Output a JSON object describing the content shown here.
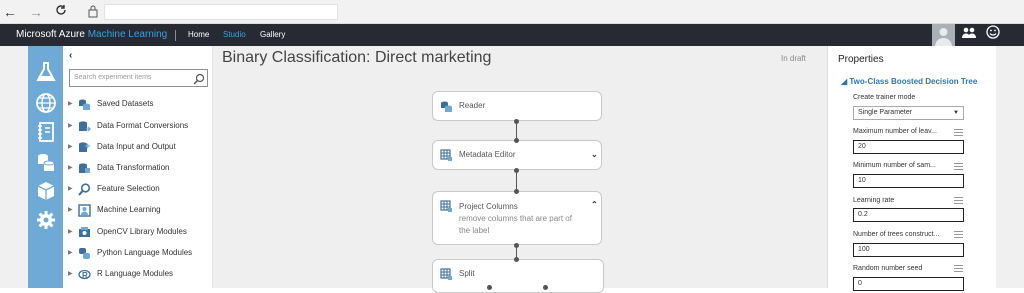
{
  "browser": {
    "back_icon": "back-arrow-icon",
    "forward_icon": "forward-arrow-icon",
    "refresh_icon": "refresh-icon",
    "lock_icon": "lock-icon",
    "address": ""
  },
  "header": {
    "brand_prefix": "Microsoft Azure",
    "brand_product": "Machine Learning",
    "nav": [
      "Home",
      "Studio",
      "Gallery"
    ],
    "active_nav": "Studio",
    "bg_color": "#272a33",
    "accent_color": "#3c9fe0"
  },
  "iconbar": {
    "color": "#6fa9d6",
    "icons": [
      "flask-icon",
      "globe-icon",
      "notebook-icon",
      "datasets-icon",
      "cube-icon",
      "gear-icon"
    ]
  },
  "palette": {
    "collapse_glyph": "‹",
    "search_placeholder": "Search experiment items",
    "items": [
      {
        "label": "Saved Datasets",
        "icon": "datasets-icon"
      },
      {
        "label": "Data Format Conversions",
        "icon": "conversion-icon"
      },
      {
        "label": "Data Input and Output",
        "icon": "io-icon"
      },
      {
        "label": "Data Transformation",
        "icon": "transform-icon"
      },
      {
        "label": "Feature Selection",
        "icon": "search-icon"
      },
      {
        "label": "Machine Learning",
        "icon": "ml-icon"
      },
      {
        "label": "OpenCV Library Modules",
        "icon": "opencv-icon"
      },
      {
        "label": "Python Language Modules",
        "icon": "python-icon"
      },
      {
        "label": "R Language Modules",
        "icon": "r-icon"
      }
    ]
  },
  "experiment": {
    "title": "Binary Classification: Direct marketing",
    "status": "In draft",
    "nodes": [
      {
        "label": "Reader",
        "sub": ""
      },
      {
        "label": "Metadata Editor",
        "sub": ""
      },
      {
        "label": "Project Columns",
        "sub": "remove columns that are part of the label"
      },
      {
        "label": "Split",
        "sub": ""
      }
    ]
  },
  "properties": {
    "title": "Properties",
    "module": "Two-Class Boosted Decision Tree",
    "fields": [
      {
        "label": "Create trainer mode",
        "value": "Single Parameter",
        "type": "select"
      },
      {
        "label": "Maximum number of leav...",
        "value": "20",
        "type": "text"
      },
      {
        "label": "Minimum number of sam...",
        "value": "10",
        "type": "text"
      },
      {
        "label": "Learning rate",
        "value": "0.2",
        "type": "text"
      },
      {
        "label": "Number of trees construct...",
        "value": "100",
        "type": "text"
      },
      {
        "label": "Random number seed",
        "value": "0",
        "type": "text"
      }
    ]
  }
}
